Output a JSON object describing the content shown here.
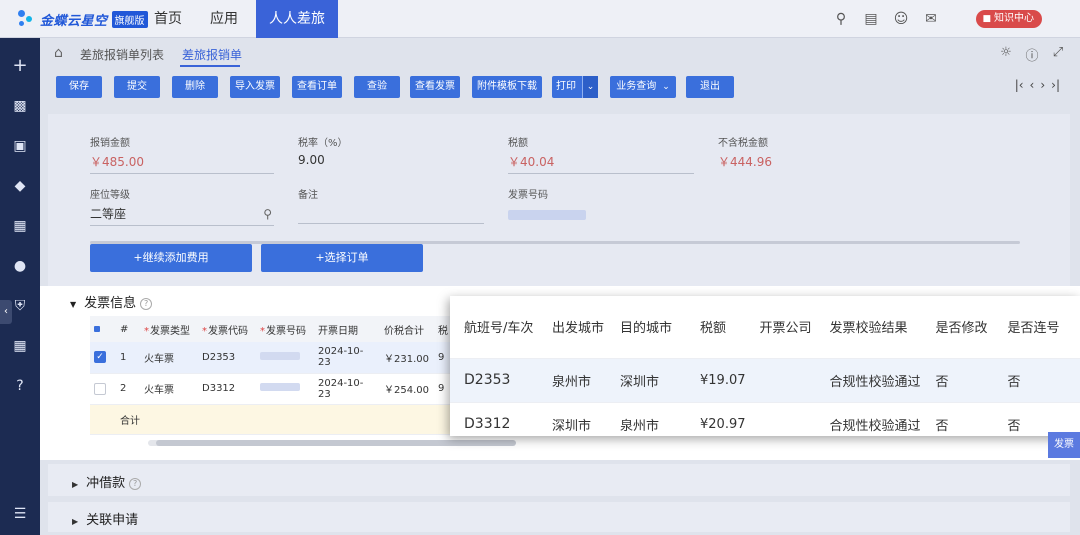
{
  "topbar": {
    "logo_text": "金蝶云星空",
    "logo_badge": "旗舰版",
    "nav": [
      "首页",
      "应用",
      "人人差旅"
    ],
    "knowledge_label": "知识中心"
  },
  "breadcrumb": {
    "items": [
      "差旅报销单列表",
      "差旅报销单"
    ]
  },
  "toolbar": {
    "buttons": [
      "保存",
      "提交",
      "删除",
      "导入发票",
      "查看订单",
      "查验",
      "查看发票",
      "附件模板下载",
      "打印",
      "业务查询",
      "退出"
    ]
  },
  "form": {
    "reimburse_amount": {
      "label": "报销金额",
      "value": "￥485.00"
    },
    "tax_rate": {
      "label": "税率（%）",
      "value": "9.00"
    },
    "tax_amount": {
      "label": "税额",
      "value": "￥40.04"
    },
    "amount_ex_tax": {
      "label": "不含税金额",
      "value": "￥444.96"
    },
    "seat_class": {
      "label": "座位等级",
      "value": "二等座"
    },
    "remark": {
      "label": "备注",
      "value": ""
    },
    "invoice_no": {
      "label": "发票号码",
      "value": ""
    },
    "add_expense_label": "+继续添加费用",
    "select_order_label": "+选择订单"
  },
  "invoice_section": {
    "title": "发票信息",
    "columns": [
      "#",
      "发票类型",
      "发票代码",
      "发票号码",
      "开票日期",
      "价税合计",
      "税"
    ],
    "rows": [
      {
        "no": "1",
        "type": "火车票",
        "code": "D2353",
        "date": "2024-10-23",
        "total": "￥231.00",
        "tax": "9",
        "checked": true
      },
      {
        "no": "2",
        "type": "火车票",
        "code": "D3312",
        "date": "2024-10-23",
        "total": "￥254.00",
        "tax": "9",
        "checked": false
      }
    ],
    "sum_label": "合计"
  },
  "overlay_table": {
    "columns": [
      "航班号/车次",
      "出发城市",
      "目的城市",
      "税额",
      "开票公司",
      "发票校验结果",
      "是否修改",
      "是否连号"
    ],
    "rows": [
      [
        "D2353",
        "泉州市",
        "深圳市",
        "¥19.07",
        "",
        "合规性校验通过",
        "否",
        "否"
      ],
      [
        "D3312",
        "深圳市",
        "泉州市",
        "¥20.97",
        "",
        "合规性校验通过",
        "否",
        "否"
      ]
    ]
  },
  "sections": {
    "loan": "冲借款",
    "related": "关联申请"
  },
  "side_tab_label": "发票"
}
